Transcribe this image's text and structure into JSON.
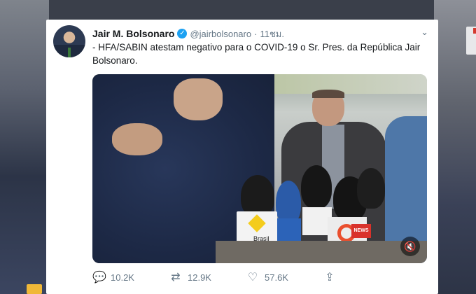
{
  "tweet": {
    "author_name": "Jair M. Bolsonaro",
    "verified_icon": "verified-badge-icon",
    "handle": "@jairbolsonaro",
    "separator": "·",
    "time": "11ชม.",
    "menu_icon": "chevron-down-icon",
    "text": "- HFA/SABIN atestam negativo para o COVID-19 o Sr. Pres. da República Jair Bolsonaro.",
    "media": {
      "type": "video",
      "mic_flag_label": "Brasil",
      "mic_tag_label": "NEWS",
      "mute_icon": "speaker-muted-icon"
    },
    "actions": {
      "reply_count": "10.2K",
      "retweet_count": "12.9K",
      "like_count": "57.6K",
      "reply_icon": "reply-icon",
      "retweet_icon": "retweet-icon",
      "like_icon": "heart-icon",
      "share_icon": "share-icon"
    }
  },
  "colors": {
    "accent": "#1da1f2",
    "text_primary": "#14171a",
    "text_secondary": "#657786"
  }
}
